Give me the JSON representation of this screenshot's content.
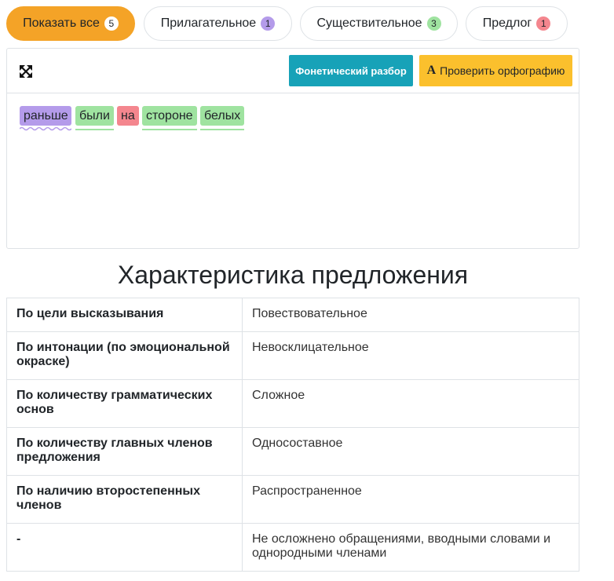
{
  "tabs": [
    {
      "label": "Показать все",
      "count": "5",
      "color": "#f4a327"
    },
    {
      "label": "Прилагательное",
      "count": "1",
      "color": "#b49bea"
    },
    {
      "label": "Существительное",
      "count": "3",
      "color": "#9fe3a0"
    },
    {
      "label": "Предлог",
      "count": "1",
      "color": "#f4868e"
    }
  ],
  "toolbar": {
    "expand_icon": "expand-arrows-icon",
    "phonetic_label": "Фонетический разбор",
    "spell_icon": "A",
    "spell_label": "Проверить орфографию"
  },
  "words": [
    {
      "text": "раньше",
      "color": "#b49bea"
    },
    {
      "text": "были",
      "color": "#9fe3a0"
    },
    {
      "text": "на",
      "color": "#f4868e"
    },
    {
      "text": "стороне",
      "color": "#9fe3a0"
    },
    {
      "text": "белых",
      "color": "#9fe3a0"
    }
  ],
  "heading": "Характеристика предложения",
  "rows": [
    {
      "key": "По цели высказывания",
      "value": "Повествовательное"
    },
    {
      "key": "По интонации (по эмоциональной окраске)",
      "value": "Невосклицательное"
    },
    {
      "key": "По количеству грамматических основ",
      "value": "Сложное"
    },
    {
      "key": "По количеству главных членов предложения",
      "value": "Односоставное"
    },
    {
      "key": "По наличию второстепенных членов",
      "value": "Распространенное"
    },
    {
      "key": "-",
      "value": "Не осложнено обращениями, вводными словами и однородными членами"
    }
  ]
}
